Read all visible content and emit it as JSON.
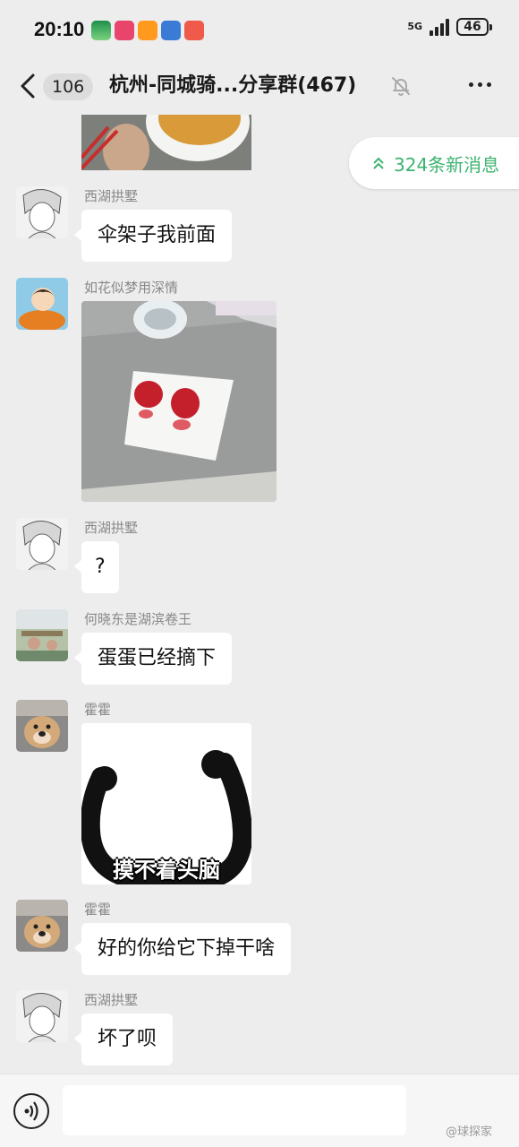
{
  "status_bar": {
    "time": "20:10",
    "network": "5G",
    "battery": "46"
  },
  "header": {
    "back_count": "106",
    "title": "杭州-同城骑...分享群(467)"
  },
  "new_messages": {
    "label": "324条新消息"
  },
  "messages": [
    {
      "sender": "西湖拱墅",
      "text": "伞架子我前面"
    },
    {
      "sender": "如花似梦用深情"
    },
    {
      "sender": "西湖拱墅",
      "text": "?"
    },
    {
      "sender": "何晓东是湖滨卷王",
      "text": "蛋蛋已经摘下"
    },
    {
      "sender": "霍霍",
      "sticker_text": "摸不着头脑"
    },
    {
      "sender": "霍霍",
      "text": "好的你给它下掉干啥"
    },
    {
      "sender": "西湖拱墅",
      "text": "坏了呗"
    }
  ],
  "watermark": "@球探家",
  "colors": {
    "background": "#ededed",
    "bubble": "#ffffff",
    "accent_green": "#3cb371"
  }
}
